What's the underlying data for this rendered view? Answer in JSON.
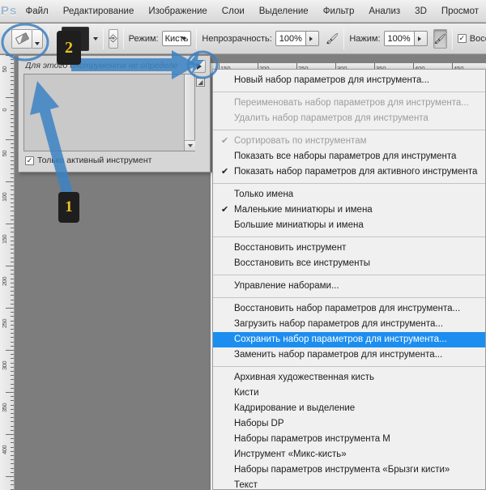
{
  "app": {
    "logo": "Ps",
    "menus": [
      "Файл",
      "Редактирование",
      "Изображение",
      "Слои",
      "Выделение",
      "Фильтр",
      "Анализ",
      "3D",
      "Просмот"
    ]
  },
  "options_bar": {
    "tool_icon": "eraser-icon",
    "tool_dropdown_icon": "chevron-down-icon",
    "brush_preview_size": "13",
    "brush_dropdown_icon": "chevron-down-icon",
    "tablet_pressure_icon": "tablet-pressure-icon",
    "mode_label": "Режим:",
    "mode_value": "Кисть",
    "opacity_label": "Непрозрачность:",
    "opacity_value": "100%",
    "airbrush_icon": "airbrush-icon",
    "flow_label": "Нажим:",
    "flow_value": "100%",
    "pressure_size_icon": "pressure-size-icon",
    "restore_label": "Восста",
    "restore_checked": true
  },
  "preset_panel": {
    "hint": "Для этого инструмента не определе",
    "menu_button_icon": "panel-menu-icon",
    "corner_icon": "resize-corner-icon",
    "scroll_down_icon": "chevron-down-icon",
    "checkbox_label": "Только активный инструмент",
    "checkbox_checked": true
  },
  "rulers": {
    "vertical_labels": [
      "50",
      "0",
      "50",
      "100",
      "150",
      "200",
      "250",
      "300",
      "350",
      "400"
    ],
    "horizontal_labels": [
      "150",
      "200",
      "250",
      "300",
      "350",
      "400",
      "450"
    ]
  },
  "context_menu": {
    "groups": [
      [
        {
          "label": "Новый набор параметров для инструмента...",
          "checked": false,
          "disabled": false,
          "selected": false
        }
      ],
      [
        {
          "label": "Переименовать набор параметров для инструмента...",
          "checked": false,
          "disabled": true,
          "selected": false
        },
        {
          "label": "Удалить набор параметров для инструмента",
          "checked": false,
          "disabled": true,
          "selected": false
        }
      ],
      [
        {
          "label": "Сортировать по инструментам",
          "checked": true,
          "disabled": true,
          "selected": false
        },
        {
          "label": "Показать все наборы параметров для инструмента",
          "checked": false,
          "disabled": false,
          "selected": false
        },
        {
          "label": "Показать набор параметров для активного инструмента",
          "checked": true,
          "disabled": false,
          "selected": false
        }
      ],
      [
        {
          "label": "Только имена",
          "checked": false,
          "disabled": false,
          "selected": false
        },
        {
          "label": "Маленькие миниатюры и имена",
          "checked": true,
          "disabled": false,
          "selected": false
        },
        {
          "label": "Большие миниатюры и имена",
          "checked": false,
          "disabled": false,
          "selected": false
        }
      ],
      [
        {
          "label": "Восстановить инструмент",
          "checked": false,
          "disabled": false,
          "selected": false
        },
        {
          "label": "Восстановить все инструменты",
          "checked": false,
          "disabled": false,
          "selected": false
        }
      ],
      [
        {
          "label": "Управление наборами...",
          "checked": false,
          "disabled": false,
          "selected": false
        }
      ],
      [
        {
          "label": "Восстановить набор параметров для инструмента...",
          "checked": false,
          "disabled": false,
          "selected": false
        },
        {
          "label": "Загрузить набор параметров для инструмента...",
          "checked": false,
          "disabled": false,
          "selected": false
        },
        {
          "label": "Сохранить набор параметров для инструмента...",
          "checked": false,
          "disabled": false,
          "selected": true
        },
        {
          "label": "Заменить набор параметров для инструмента...",
          "checked": false,
          "disabled": false,
          "selected": false
        }
      ],
      [
        {
          "label": "Архивная художественная кисть",
          "checked": false,
          "disabled": false,
          "selected": false
        },
        {
          "label": "Кисти",
          "checked": false,
          "disabled": false,
          "selected": false
        },
        {
          "label": "Кадрирование и выделение",
          "checked": false,
          "disabled": false,
          "selected": false
        },
        {
          "label": "Наборы DP",
          "checked": false,
          "disabled": false,
          "selected": false
        },
        {
          "label": "Наборы параметров инструмента M",
          "checked": false,
          "disabled": false,
          "selected": false
        },
        {
          "label": "Инструмент «Микс-кисть»",
          "checked": false,
          "disabled": false,
          "selected": false
        },
        {
          "label": "Наборы параметров инструмента  «Брызги кисти»",
          "checked": false,
          "disabled": false,
          "selected": false
        },
        {
          "label": "Текст",
          "checked": false,
          "disabled": false,
          "selected": false
        }
      ]
    ],
    "check_glyph": "✔",
    "highlight_color": "#1c8ef0"
  },
  "annotations": {
    "badge_1": "1",
    "badge_2": "2",
    "arrow_color": "#3c82c4",
    "ellipse_color": "#3c7fc0"
  }
}
